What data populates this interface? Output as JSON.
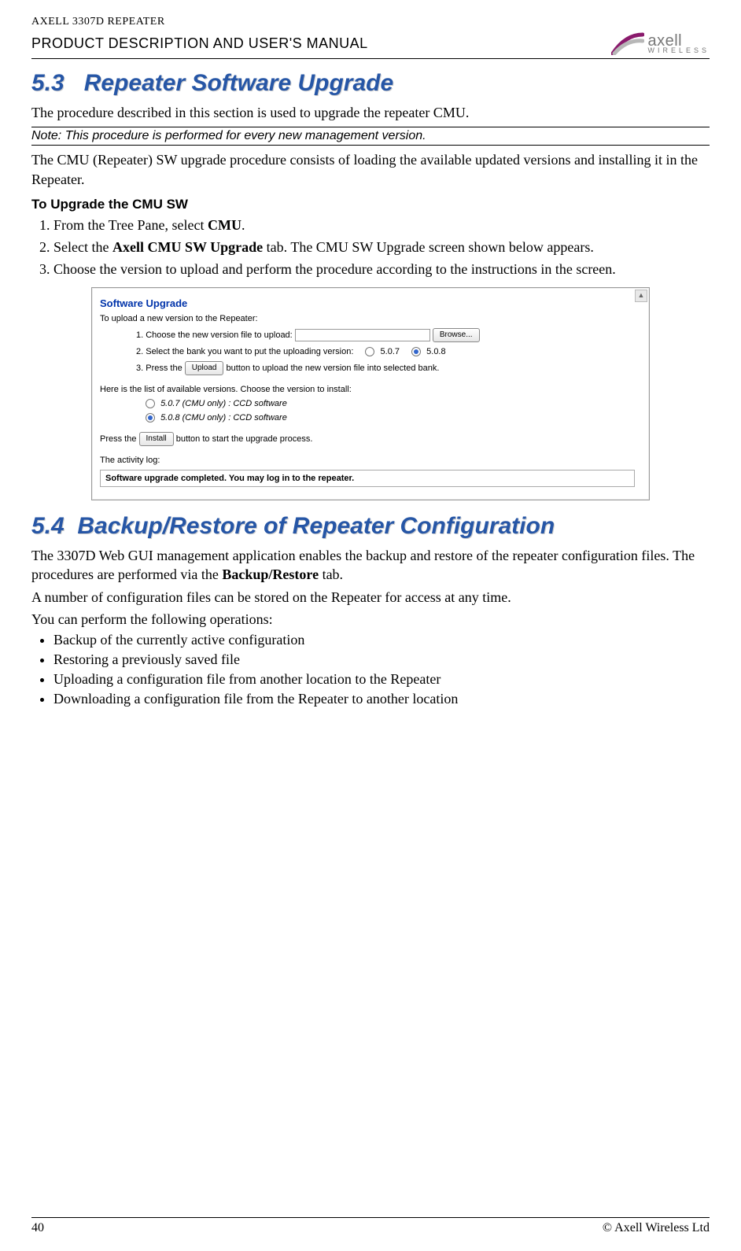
{
  "header": {
    "product_line": "AXELL 3307D REPEATER",
    "manual_title": "PRODUCT DESCRIPTION AND USER'S MANUAL",
    "logo": {
      "brand": "axell",
      "subtext": "WIRELESS"
    }
  },
  "sections": {
    "s53": {
      "number": "5.3",
      "title": "Repeater Software Upgrade",
      "intro": "The procedure described in this section is used to upgrade the repeater CMU.",
      "note": "Note: This procedure is performed for every new management version.",
      "para2": "The CMU (Repeater) SW upgrade procedure consists of loading the available updated versions and installing it in the Repeater.",
      "subhead": "To Upgrade the CMU SW",
      "steps": [
        {
          "pre": "From the Tree Pane, select ",
          "bold": "CMU",
          "post": "."
        },
        {
          "pre": "Select the ",
          "bold": "Axell CMU SW Upgrade",
          "post": " tab. The CMU SW Upgrade screen shown below appears."
        },
        {
          "pre": "Choose the version to upload and perform the procedure according to the instructions in the screen.",
          "bold": "",
          "post": ""
        }
      ]
    },
    "s54": {
      "number": "5.4",
      "title": "Backup/Restore of Repeater Configuration",
      "para1_pre": "The 3307D Web GUI management application enables the backup and restore of the repeater configuration files. The procedures are performed via the ",
      "para1_bold": "Backup/Restore",
      "para1_post": " tab.",
      "para2": "A number of configuration files can be stored on the Repeater for access at any time.",
      "para3": "You can perform the following operations:",
      "bullets": [
        "Backup of the currently active configuration",
        "Restoring a previously saved file",
        "Uploading a configuration file from another location to the Repeater",
        "Downloading a configuration file from the Repeater to another location"
      ]
    }
  },
  "screenshot": {
    "title": "Software Upgrade",
    "line_intro": "To upload a new version to the Repeater:",
    "step1_label": "1. Choose the new version file to upload:",
    "step1_browse": "Browse...",
    "step2_label": "2. Select the bank you want to put the uploading version:",
    "step2_opt_a": "5.0.7",
    "step2_opt_b": "5.0.8",
    "step3_pre": "3. Press the ",
    "step3_btn": "Upload",
    "step3_post": " button to upload the new version file into selected bank.",
    "list_intro": "Here is the list of available versions. Choose the version to install:",
    "list_a": "5.0.7 (CMU only) : CCD software",
    "list_b": "5.0.8 (CMU only) : CCD software",
    "install_pre": "Press the ",
    "install_btn": "Install",
    "install_post": " button to start the upgrade process.",
    "log_label": "The activity log:",
    "log_text": "Software upgrade completed. You may log in to the repeater."
  },
  "footer": {
    "page": "40",
    "copyright": "© Axell Wireless Ltd"
  }
}
